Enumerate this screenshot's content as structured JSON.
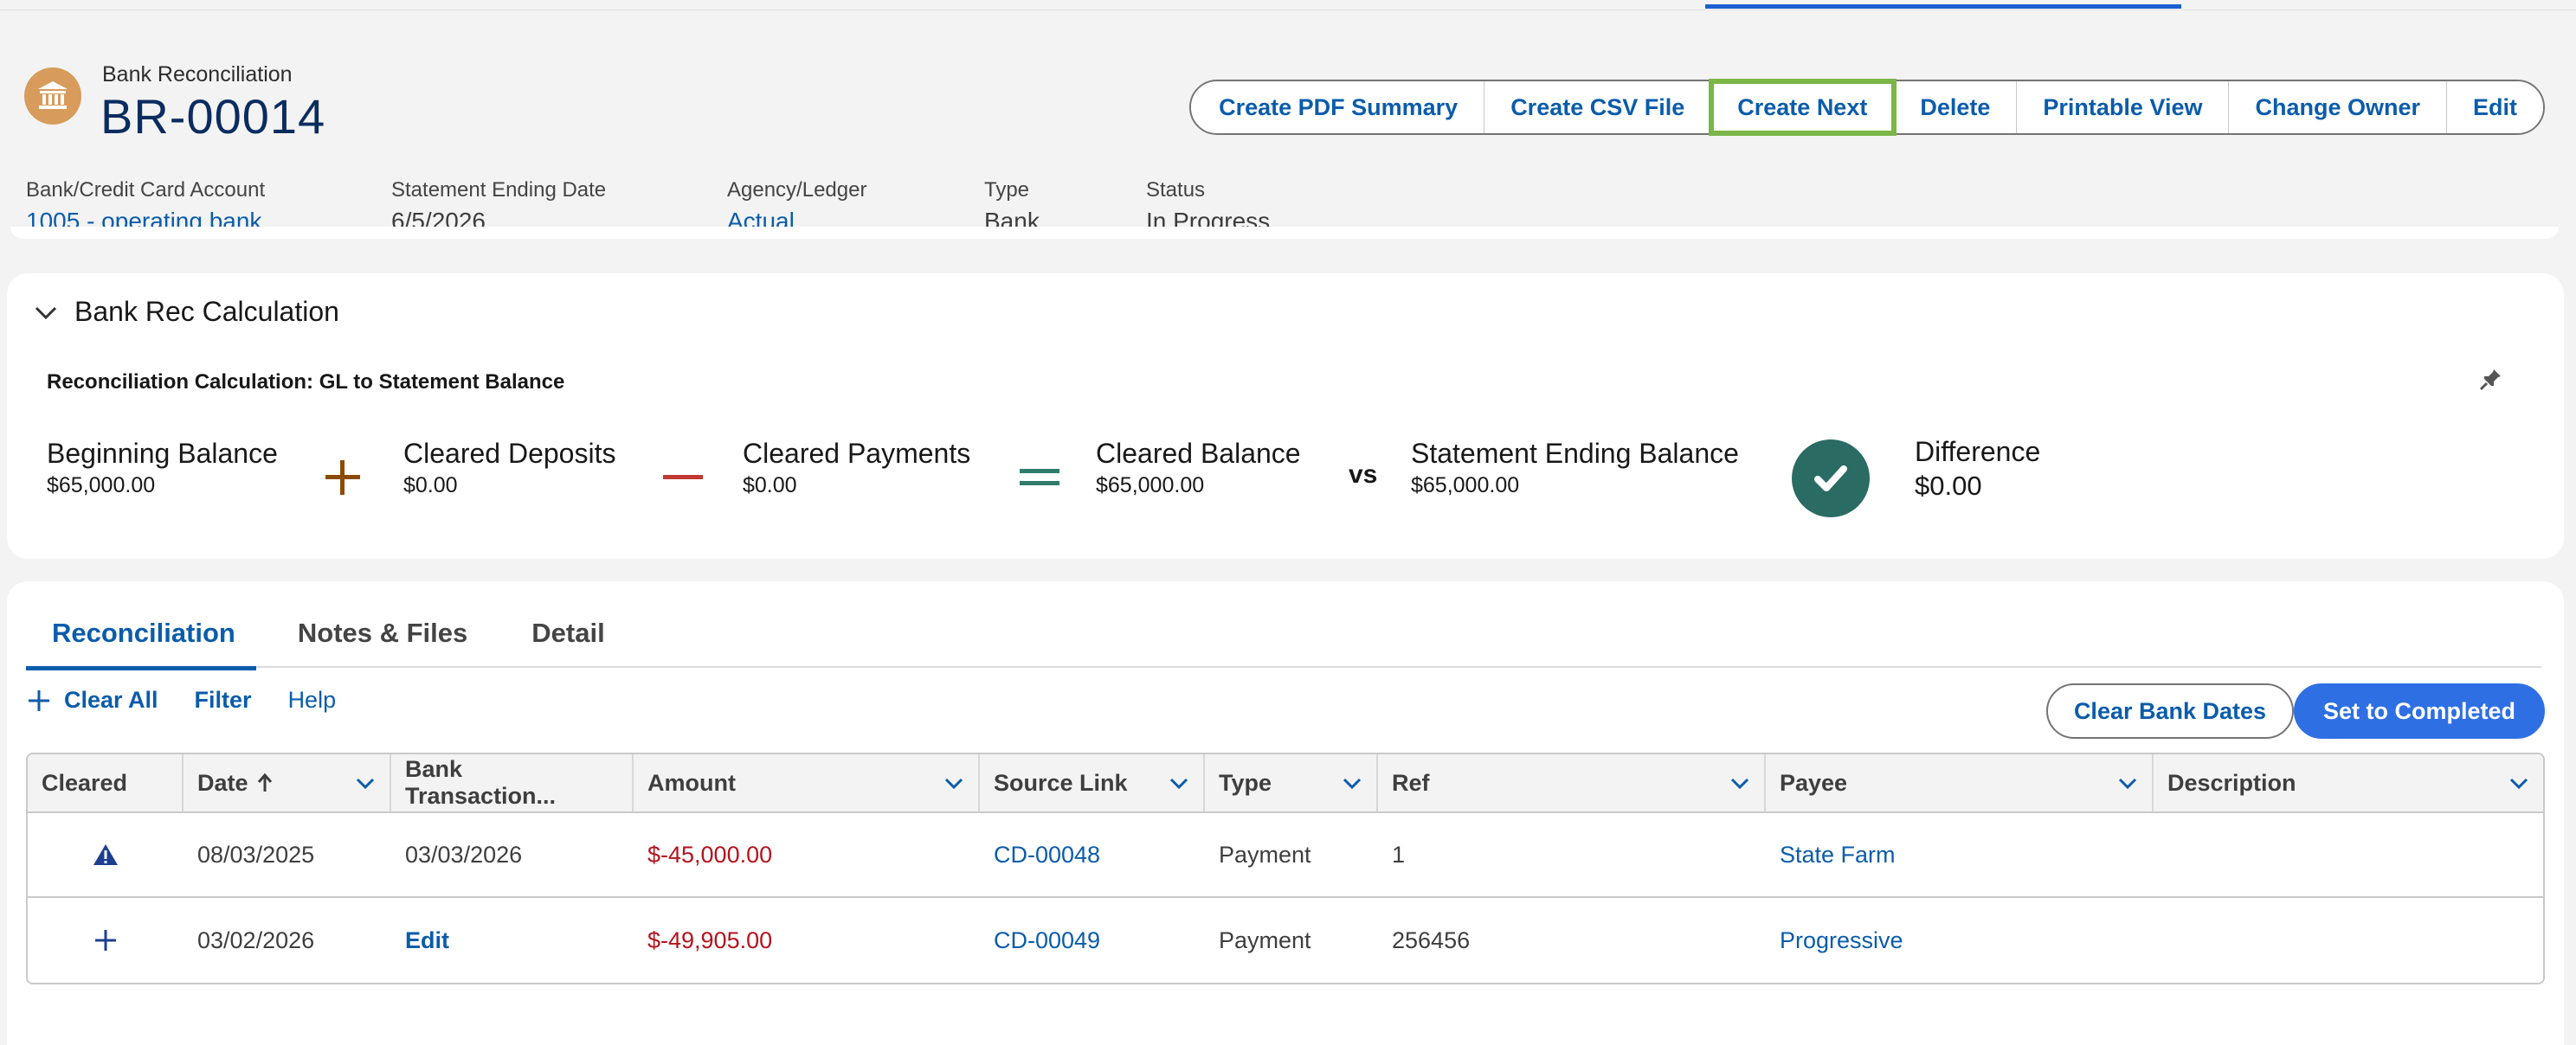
{
  "record": {
    "type_label": "Bank Reconciliation",
    "name": "BR-00014"
  },
  "actions": {
    "create_pdf": "Create PDF Summary",
    "create_csv": "Create CSV File",
    "create_next": "Create Next",
    "delete": "Delete",
    "printable": "Printable View",
    "change_owner": "Change Owner",
    "edit": "Edit"
  },
  "fields": {
    "account_label": "Bank/Credit Card Account",
    "account_value": "1005 - operating bank",
    "stmt_date_label": "Statement Ending Date",
    "stmt_date_value": "6/5/2026",
    "ledger_label": "Agency/Ledger",
    "ledger_value": "Actual",
    "type_label": "Type",
    "type_value": "Bank",
    "status_label": "Status",
    "status_value": "In Progress"
  },
  "calc": {
    "section_title": "Bank Rec Calculation",
    "subtitle": "Reconciliation Calculation: GL to Statement Balance",
    "beginning_label": "Beginning Balance",
    "beginning_value": "$65,000.00",
    "deposits_label": "Cleared Deposits",
    "deposits_value": "$0.00",
    "payments_label": "Cleared Payments",
    "payments_value": "$0.00",
    "cleared_label": "Cleared Balance",
    "cleared_value": "$65,000.00",
    "vs": "vs",
    "statement_label": "Statement Ending Balance",
    "statement_value": "$65,000.00",
    "difference_label": "Difference",
    "difference_value": "$0.00"
  },
  "tabs": {
    "reconciliation": "Reconciliation",
    "notes": "Notes & Files",
    "detail": "Detail"
  },
  "toolbar": {
    "clear_all": "Clear All",
    "filter": "Filter",
    "help": "Help",
    "clear_bank_dates": "Clear Bank Dates",
    "set_completed": "Set to Completed"
  },
  "table": {
    "headers": {
      "cleared": "Cleared",
      "date": "Date",
      "bank_tx": "Bank Transaction...",
      "amount": "Amount",
      "source": "Source Link",
      "type": "Type",
      "ref": "Ref",
      "payee": "Payee",
      "description": "Description"
    },
    "rows": [
      {
        "cleared_icon": "warning-icon",
        "date": "08/03/2025",
        "bank_tx": "03/03/2026",
        "amount": "$-45,000.00",
        "source": "CD-00048",
        "type": "Payment",
        "ref": "1",
        "payee": "State Farm",
        "description": ""
      },
      {
        "cleared_icon": "plus-icon",
        "date": "03/02/2026",
        "bank_tx": "Edit",
        "amount": "$-49,905.00",
        "source": "CD-00049",
        "type": "Payment",
        "ref": "256456",
        "payee": "Progressive",
        "description": ""
      }
    ]
  },
  "colors": {
    "brand_blue": "#0b5cab",
    "primary_button": "#2f6fe4",
    "highlight_outline": "#7ab648",
    "negative_amount": "#b5131d",
    "check_circle": "#2a6b63",
    "record_icon_bg": "#d79b5b"
  }
}
